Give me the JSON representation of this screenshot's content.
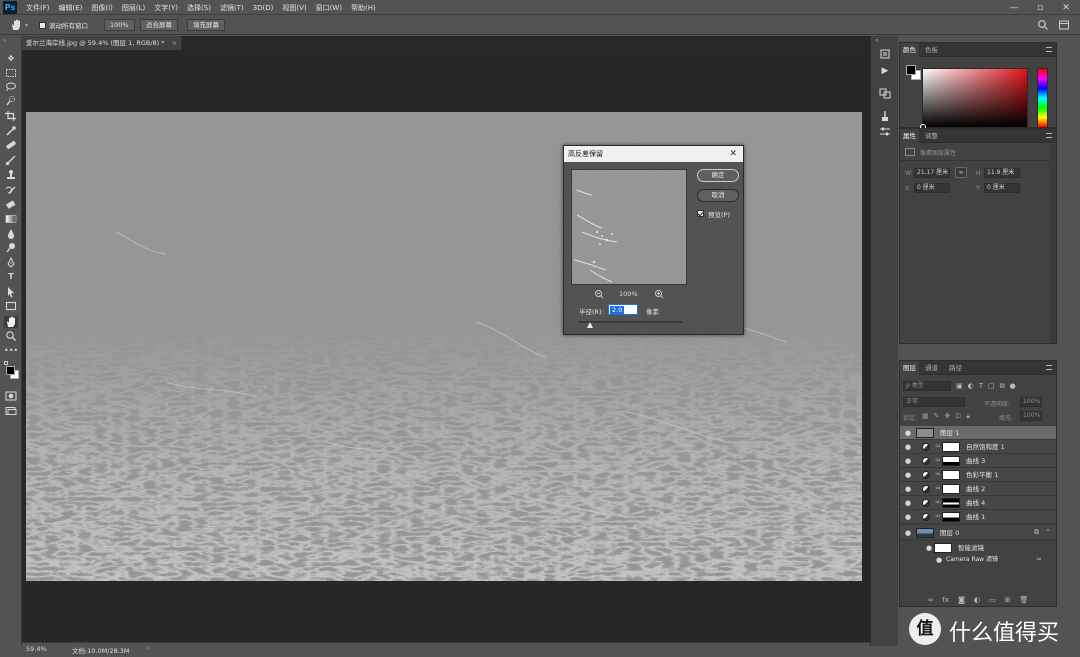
{
  "menubar": {
    "logo": "Ps",
    "items": [
      "文件(F)",
      "编辑(E)",
      "图像(I)",
      "图层(L)",
      "文字(Y)",
      "选择(S)",
      "滤镜(T)",
      "3D(D)",
      "视图(V)",
      "窗口(W)",
      "帮助(H)"
    ],
    "controls": [
      "—",
      "▫",
      "✕"
    ]
  },
  "optionsbar": {
    "scroll_all_label": "滚动所有窗口",
    "zoom_100": "100%",
    "fit_screen": "适合屏幕",
    "fill_screen": "填充屏幕"
  },
  "document": {
    "tab_title": "爱尔兰海岸线.jpg @ 59.4% (图层 1, RGB/8) *",
    "tab_close": "×"
  },
  "status": {
    "zoom": "59.4%",
    "doc_size": "文档:10.0M/28.3M"
  },
  "dialog": {
    "title": "高反差保留",
    "close": "✕",
    "ok_label": "确定",
    "cancel_label": "取消",
    "preview_label": "预览(P)",
    "preview_checked": true,
    "zoom_level": "100%",
    "radius_label": "半径(R):",
    "radius_value": "2.0",
    "radius_unit": "像素",
    "radius_slider_fraction": 0.12
  },
  "color_panel": {
    "tabs": [
      "颜色",
      "色板"
    ],
    "foreground": "#000000",
    "background": "#ffffff"
  },
  "properties_panel": {
    "tabs": [
      "属性",
      "调整"
    ],
    "subtitle": "像素图层属性",
    "w_label": "W:",
    "w_value": "21.17 厘米",
    "h_label": "H:",
    "h_value": "11.9 厘米",
    "x_label": "X:",
    "x_value": "0 厘米",
    "y_label": "Y:",
    "y_value": "0 厘米"
  },
  "layers_panel": {
    "tabs": [
      "图层",
      "通道",
      "路径"
    ],
    "filter_placeholder": "ρ 类型",
    "blend_mode": "正常",
    "opacity_label": "不透明度:",
    "opacity_value": "100%",
    "lock_label": "锁定:",
    "fill_label": "填充:",
    "fill_value": "100%",
    "layers": [
      {
        "name": "图层 1",
        "kind": "pixel",
        "selected": true
      },
      {
        "name": "自然饱和度 1",
        "kind": "adjustment",
        "selected": false
      },
      {
        "name": "曲线 3",
        "kind": "adjustment",
        "selected": false
      },
      {
        "name": "色彩平衡 1",
        "kind": "adjustment",
        "selected": false
      },
      {
        "name": "曲线 2",
        "kind": "adjustment",
        "selected": false
      },
      {
        "name": "曲线 4",
        "kind": "adjustment",
        "selected": false
      },
      {
        "name": "曲线 1",
        "kind": "adjustment",
        "selected": false
      },
      {
        "name": "图层 0",
        "kind": "smart",
        "selected": false
      }
    ],
    "smart_filters_label": "智能滤镜",
    "camera_raw_label": "Camera Raw 滤镜"
  },
  "watermark": {
    "text": "什么值得买",
    "logo_char": "值"
  },
  "colors": {
    "accent_blue": "#1e6fd9",
    "panel_bg": "#424242",
    "app_bg": "#535353"
  }
}
